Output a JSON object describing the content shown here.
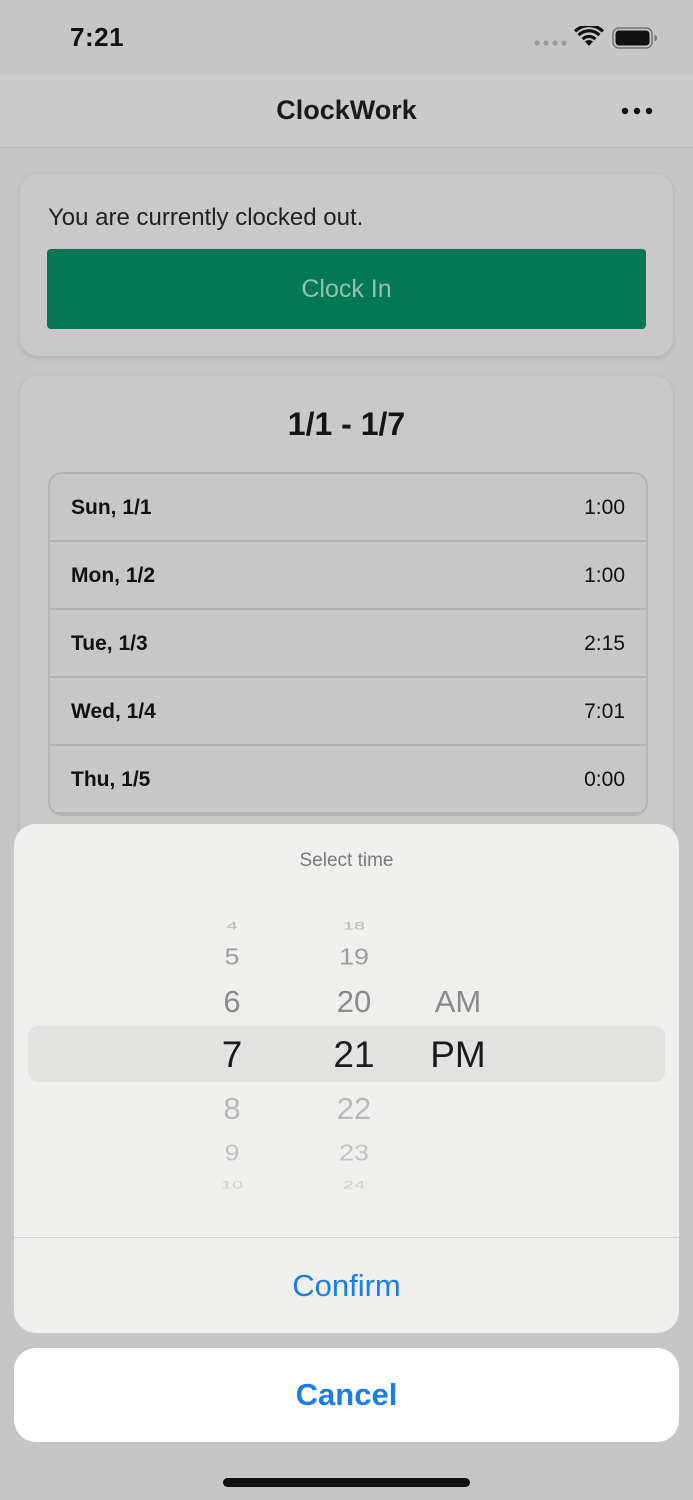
{
  "status_bar": {
    "time": "7:21"
  },
  "nav": {
    "title": "ClockWork",
    "more_icon": "ellipsis-icon"
  },
  "clock_card": {
    "status_text": "You are currently clocked out.",
    "button_label": "Clock In",
    "button_color": "#067754"
  },
  "week_card": {
    "range": "1/1 - 1/7",
    "days": [
      {
        "label": "Sun, 1/1",
        "hours": "1:00"
      },
      {
        "label": "Mon, 1/2",
        "hours": "1:00"
      },
      {
        "label": "Tue, 1/3",
        "hours": "2:15"
      },
      {
        "label": "Wed, 1/4",
        "hours": "7:01"
      },
      {
        "label": "Thu, 1/5",
        "hours": "0:00"
      }
    ]
  },
  "time_picker": {
    "title": "Select time",
    "hours": [
      "4",
      "5",
      "6",
      "7",
      "8",
      "9",
      "10"
    ],
    "minutes": [
      "18",
      "19",
      "20",
      "21",
      "22",
      "23",
      "24"
    ],
    "periods": [
      "AM",
      "PM"
    ],
    "selected": {
      "hour": "7",
      "minute": "21",
      "period": "PM"
    },
    "confirm_label": "Confirm",
    "cancel_label": "Cancel",
    "action_color": "#1a7de8"
  }
}
